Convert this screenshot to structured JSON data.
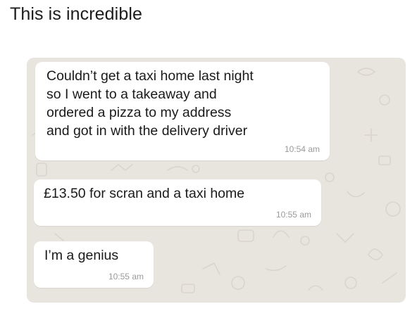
{
  "post": {
    "caption": "This is incredible"
  },
  "chat": {
    "wallpaper_color": "#e8e5df",
    "bubble_color": "#ffffff",
    "messages": [
      {
        "text": "Couldn’t get a taxi home last night\nso I went to a takeaway and\nordered a pizza to my address\nand got in with the delivery driver",
        "time": "10:54 am"
      },
      {
        "text": "£13.50 for scran and a taxi home",
        "time": "10:55 am"
      },
      {
        "text": "I’m a genius",
        "time": "10:55 am"
      }
    ]
  }
}
